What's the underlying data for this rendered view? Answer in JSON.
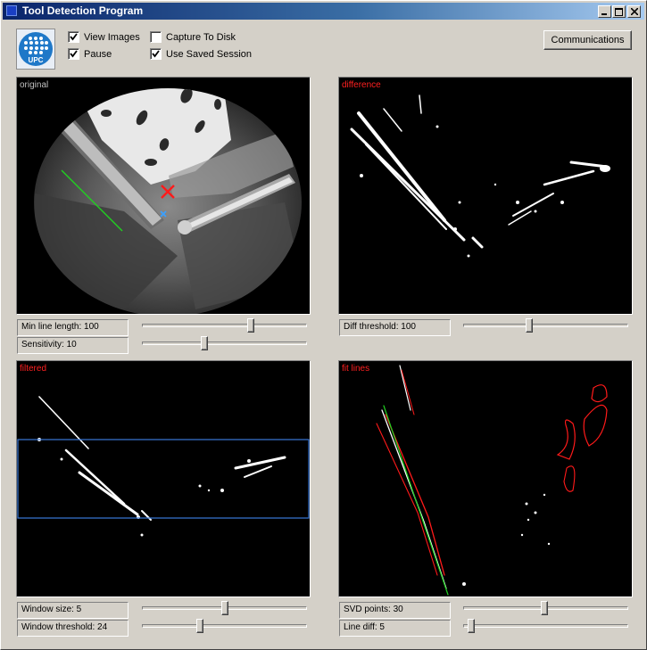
{
  "window": {
    "title": "Tool Detection Program",
    "controls": {
      "minimize": "minimize-icon",
      "maximize": "maximize-icon",
      "close": "close-icon"
    }
  },
  "logo": {
    "text": "UPC"
  },
  "options": {
    "view_images": {
      "label": "View Images",
      "checked": true
    },
    "pause": {
      "label": "Pause",
      "checked": true
    },
    "capture_to_disk": {
      "label": "Capture To Disk",
      "checked": false
    },
    "use_saved_session": {
      "label": "Use Saved Session",
      "checked": true
    }
  },
  "communications_label": "Communications",
  "panels": {
    "original": {
      "label": "original",
      "label_color": "#c0c0c0"
    },
    "difference": {
      "label": "difference",
      "label_color": "#ff2020"
    },
    "filtered": {
      "label": "filtered",
      "label_color": "#ff2020"
    },
    "fit_lines": {
      "label": "fit lines",
      "label_color": "#ff2020"
    }
  },
  "controls": {
    "min_line_length": {
      "label": "Min line length: 100",
      "level": 0.72
    },
    "sensitivity": {
      "label": "Sensitivity: 10",
      "level": 0.38
    },
    "diff_threshold": {
      "label": "Diff threshold: 100",
      "level": 0.4
    },
    "window_size": {
      "label": "Window size: 5",
      "level": 0.5
    },
    "window_threshold": {
      "label": "Window threshold: 24",
      "level": 0.35
    },
    "svd_points": {
      "label": "SVD points: 30",
      "level": 0.49
    },
    "line_diff": {
      "label": "Line diff: 5",
      "level": 0.05
    }
  },
  "colors": {
    "titlebar_start": "#0a246a",
    "titlebar_end": "#a6caf0",
    "window_bg": "#d4d0c8",
    "marker_red": "#ff1a1a",
    "marker_blue": "#3aa0ff",
    "fit_green": "#20d020",
    "roi_blue": "#3a78d8"
  }
}
